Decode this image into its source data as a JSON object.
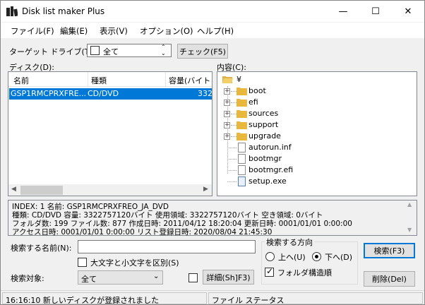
{
  "window": {
    "title": "Disk list maker Plus",
    "minimize": "—",
    "maximize": "☐",
    "close": "✕"
  },
  "menu": [
    "ファイル(F)",
    "編集(E)",
    "表示(V)",
    "オプション(O)",
    "ヘルプ(H)"
  ],
  "target": {
    "label": "ターゲット ドライブ(T):",
    "value": "全て",
    "check_button": "チェック(F5)"
  },
  "disk_list": {
    "label": "ディスク(D):",
    "columns": [
      "名前",
      "種類",
      "容量(バイト"
    ],
    "rows": [
      {
        "name": "GSP1RMCPRXFRE...",
        "type": "CD/DVD",
        "size": "332"
      }
    ]
  },
  "contents": {
    "label": "内容(C):",
    "root": "¥",
    "folders": [
      "boot",
      "efi",
      "sources",
      "support",
      "upgrade"
    ],
    "files": [
      "autorun.inf",
      "bootmgr",
      "bootmgr.efi",
      "setup.exe"
    ]
  },
  "info": {
    "lines": [
      "INDEX: 1 名前: GSP1RMCPRXFREO_JA_DVD",
      "種類: CD/DVD 容量: 3322757120バイト 使用領域: 3322757120バイト 空き領域: 0バイト",
      "フォルダ数: 199 ファイル数: 877 作成日時: 2011/04/12 18:20:04 更新日時: 0001/01/01 0:00:00",
      "アクセス日時: 0001/01/01 0:00:00 リスト登録日時: 2020/08/04 21:45:30"
    ]
  },
  "search": {
    "name_label": "検索する名前(N):",
    "name_value": "",
    "case_label": "大文字と小文字を区別(S)",
    "target_label": "検索対象:",
    "target_value": "全て",
    "detail_button": "詳細(Sh]F3)",
    "direction_label": "検索する方向",
    "up_label": "上へ(U)",
    "down_label": "下へ(D)",
    "folder_order_label": "フォルダ構造順",
    "search_button": "検索(F3)",
    "delete_button": "削除(Del)"
  },
  "status": {
    "message": "16:16:10 新しいディスクが登録されました",
    "file_status": "ファイル ステータス"
  }
}
